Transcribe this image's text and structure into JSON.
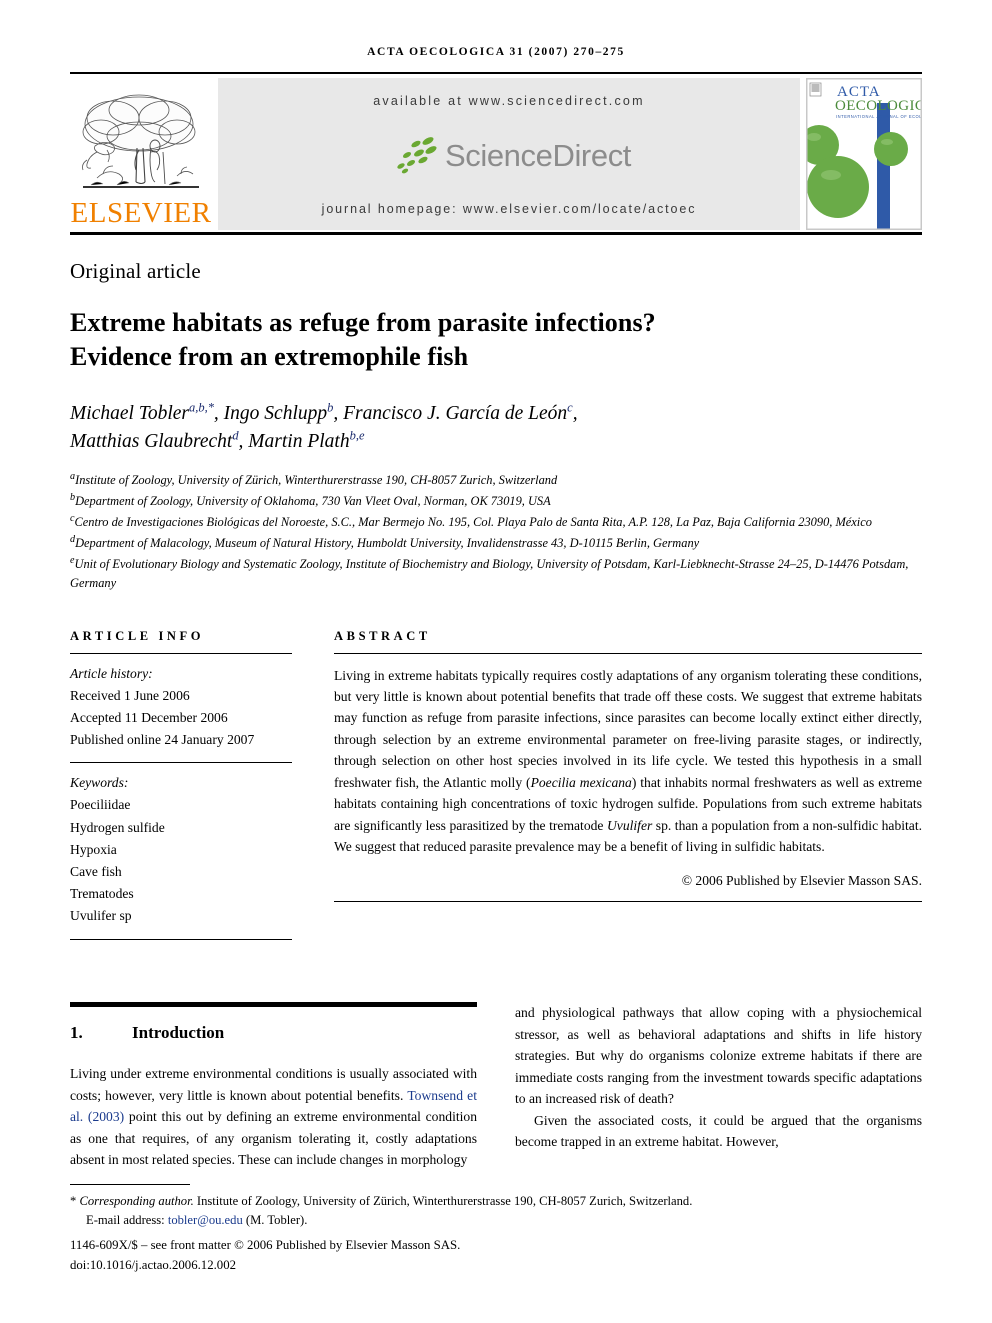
{
  "running_head": "ACTA OECOLOGICA 31 (2007) 270–275",
  "masthead": {
    "publisher_name": "ELSEVIER",
    "publisher_logo_alt": "elsevier-tree-logo",
    "available_at": "available at www.sciencedirect.com",
    "sciencedirect_wordmark": "ScienceDirect",
    "journal_homepage": "journal homepage: www.elsevier.com/locate/actoec",
    "cover": {
      "line1": "ACTA",
      "line2": "OECOLOGICA",
      "tagline": "INTERNATIONAL JOURNAL OF ECOLOGY"
    },
    "colors": {
      "elsevier_orange": "#f08000",
      "sciencedirect_gray": "#8c8c8c",
      "leaf_green": "#6aa832",
      "band_gray": "#e8e8e8",
      "cover_blue": "#2f5aa8",
      "cover_green": "#6aab48"
    }
  },
  "article_type": "Original article",
  "title": "Extreme habitats as refuge from parasite infections? Evidence from an extremophile fish",
  "title_line1": "Extreme habitats as refuge from parasite infections?",
  "title_line2": "Evidence from an extremophile fish",
  "authors_line1_parts": [
    {
      "name": "Michael Tobler",
      "sup": "a,b,*"
    },
    {
      "name": "Ingo Schlupp",
      "sup": "b"
    },
    {
      "name": "Francisco J. García de León",
      "sup": "c"
    }
  ],
  "authors_line2_parts": [
    {
      "name": "Matthias Glaubrecht",
      "sup": "d"
    },
    {
      "name": "Martin Plath",
      "sup": "b,e"
    }
  ],
  "affiliations": [
    {
      "marker": "a",
      "text": "Institute of Zoology, University of Zürich, Winterthurerstrasse 190, CH-8057 Zurich, Switzerland"
    },
    {
      "marker": "b",
      "text": "Department of Zoology, University of Oklahoma, 730 Van Vleet Oval, Norman, OK 73019, USA"
    },
    {
      "marker": "c",
      "text": "Centro de Investigaciones Biológicas del Noroeste, S.C., Mar Bermejo No. 195, Col. Playa Palo de Santa Rita, A.P. 128, La Paz, Baja California 23090, México"
    },
    {
      "marker": "d",
      "text": "Department of Malacology, Museum of Natural History, Humboldt University, Invalidenstrasse 43, D-10115 Berlin, Germany"
    },
    {
      "marker": "e",
      "text": "Unit of Evolutionary Biology and Systematic Zoology, Institute of Biochemistry and Biology, University of Potsdam, Karl-Liebknecht-Strasse 24–25, D-14476 Potsdam, Germany"
    }
  ],
  "article_info": {
    "heading": "ARTICLE INFO",
    "history_label": "Article history:",
    "history": [
      "Received 1 June 2006",
      "Accepted 11 December 2006",
      "Published online 24 January 2007"
    ],
    "keywords_label": "Keywords:",
    "keywords": [
      "Poeciliidae",
      "Hydrogen sulfide",
      "Hypoxia",
      "Cave fish",
      "Trematodes",
      "Uvulifer sp"
    ]
  },
  "abstract": {
    "heading": "ABSTRACT",
    "text_part1": "Living in extreme habitats typically requires costly adaptations of any organism tolerating these conditions, but very little is known about potential benefits that trade off these costs. We suggest that extreme habitats may function as refuge from parasite infections, since parasites can become locally extinct either directly, through selection by an extreme environmental parameter on free-living parasite stages, or indirectly, through selection on other host species involved in its life cycle. We tested this hypothesis in a small freshwater fish, the Atlantic molly (",
    "italic1": "Poecilia mexicana",
    "text_part2": ") that inhabits normal freshwaters as well as extreme habitats containing high concentrations of toxic hydrogen sulfide. Populations from such extreme habitats are significantly less parasitized by the trematode ",
    "italic2": "Uvulifer",
    "text_part3": " sp. than a population from a non-sulfidic habitat. We suggest that reduced parasite prevalence may be a benefit of living in sulfidic habitats.",
    "copyright": "© 2006 Published by Elsevier Masson SAS."
  },
  "sections": {
    "intro_number": "1.",
    "intro_title": "Introduction",
    "left_column_text_part1": "Living under extreme environmental conditions is usually associated with costs; however, very little is known about potential benefits. ",
    "left_column_citation": "Townsend et al. (2003)",
    "left_column_text_part2": " point this out by defining an extreme environmental condition as one that requires, of any organism tolerating it, costly adaptations absent in most related species. These can include changes in morphology",
    "right_column_para1": "and physiological pathways that allow coping with a physiochemical stressor, as well as behavioral adaptations and shifts in life history strategies. But why do organisms colonize extreme habitats if there are immediate costs ranging from the investment towards specific adaptations to an increased risk of death?",
    "right_column_para2": "Given the associated costs, it could be argued that the organisms become trapped in an extreme habitat. However,"
  },
  "footnotes": {
    "corresponding_marker": "*",
    "corresponding_label": "Corresponding author.",
    "corresponding_address": " Institute of Zoology, University of Zürich, Winterthurerstrasse 190, CH-8057 Zurich, Switzerland.",
    "email_label": "E-mail address:",
    "email": "tobler@ou.edu",
    "email_owner": "(M. Tobler).",
    "issn_line": "1146-609X/$ – see front matter © 2006 Published by Elsevier Masson SAS.",
    "doi_line": "doi:10.1016/j.actao.2006.12.002"
  }
}
